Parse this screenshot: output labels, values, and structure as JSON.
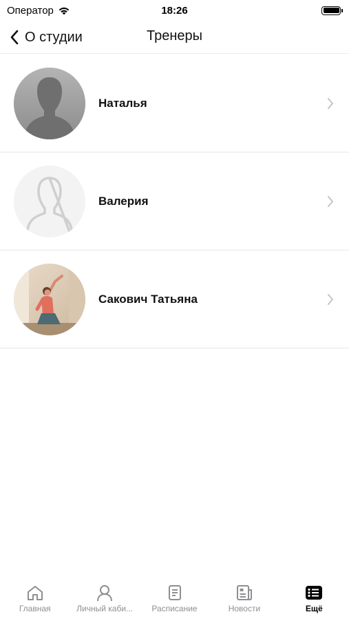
{
  "status_bar": {
    "carrier": "Оператор",
    "time": "18:26"
  },
  "nav": {
    "back_label": "О студии",
    "title": "Тренеры"
  },
  "trainers": [
    {
      "name": "Наталья",
      "avatar": "silhouette-filled"
    },
    {
      "name": "Валерия",
      "avatar": "silhouette-outline"
    },
    {
      "name": "Сакович Татьяна",
      "avatar": "photo"
    }
  ],
  "tab_bar": {
    "tabs": [
      {
        "label": "Главная",
        "icon": "home-icon",
        "active": false
      },
      {
        "label": "Личный каби...",
        "icon": "person-icon",
        "active": false
      },
      {
        "label": "Расписание",
        "icon": "schedule-icon",
        "active": false
      },
      {
        "label": "Новости",
        "icon": "news-icon",
        "active": false
      },
      {
        "label": "Ещё",
        "icon": "more-icon",
        "active": true
      }
    ]
  },
  "colors": {
    "inactive_tab": "#8e8e93",
    "active_tab": "#000000",
    "separator": "#e8e8e8"
  }
}
